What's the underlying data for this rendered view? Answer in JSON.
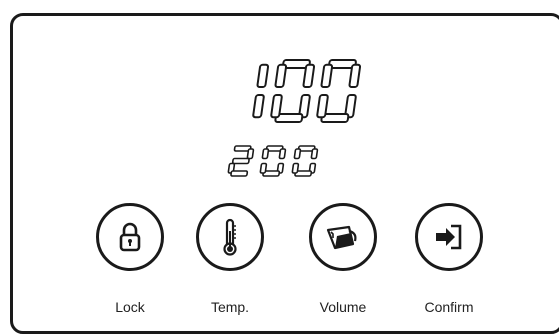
{
  "display": {
    "main_value": "100",
    "secondary_value": "200"
  },
  "buttons": [
    {
      "id": "lock",
      "label": "Lock",
      "icon": "lock-icon"
    },
    {
      "id": "temp",
      "label": "Temp.",
      "icon": "thermometer-icon"
    },
    {
      "id": "volume",
      "label": "Volume",
      "icon": "measuring-cup-icon"
    },
    {
      "id": "confirm",
      "label": "Confirm",
      "icon": "enter-icon"
    }
  ],
  "colors": {
    "stroke": "#1a1a1a",
    "background": "#ffffff"
  }
}
